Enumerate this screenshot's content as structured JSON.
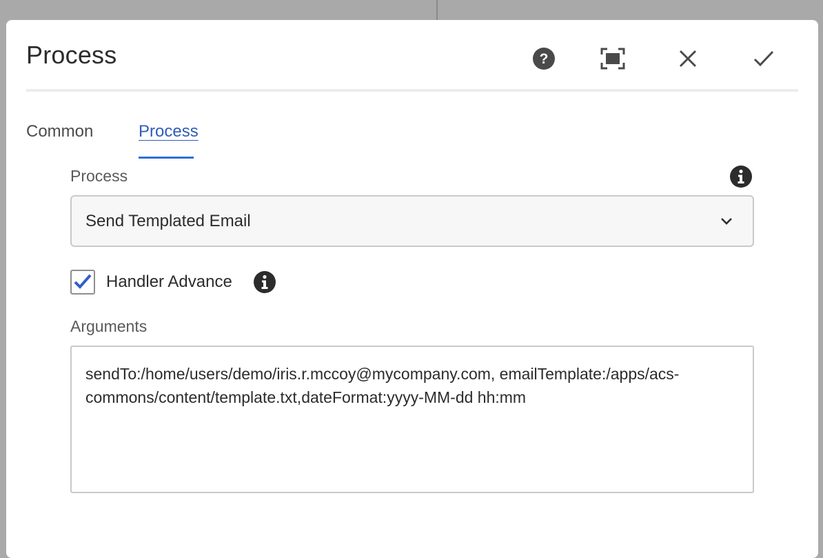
{
  "dialog": {
    "title": "Process",
    "actions": {
      "help_icon": "help-icon",
      "fullscreen_icon": "fullscreen-icon",
      "close_icon": "close-icon",
      "confirm_icon": "checkmark-icon"
    }
  },
  "tabs": [
    {
      "label": "Common",
      "selected": false
    },
    {
      "label": "Process",
      "selected": true
    }
  ],
  "form": {
    "process": {
      "label": "Process",
      "value": "Send Templated Email",
      "info_icon": "info-icon"
    },
    "handler_advance": {
      "label": "Handler Advance",
      "checked": true,
      "info_icon": "info-icon"
    },
    "arguments": {
      "label": "Arguments",
      "value": "sendTo:/home/users/demo/iris.r.mccoy@mycompany.com, emailTemplate:/apps/acs-commons/content/template.txt,dateFormat:yyyy-MM-dd hh:mm"
    }
  },
  "colors": {
    "accent": "#2f6fd6",
    "tab_selected_text": "#2f5db8",
    "checkmark": "#2f5fc9",
    "backdrop": "#a9a9a9"
  }
}
